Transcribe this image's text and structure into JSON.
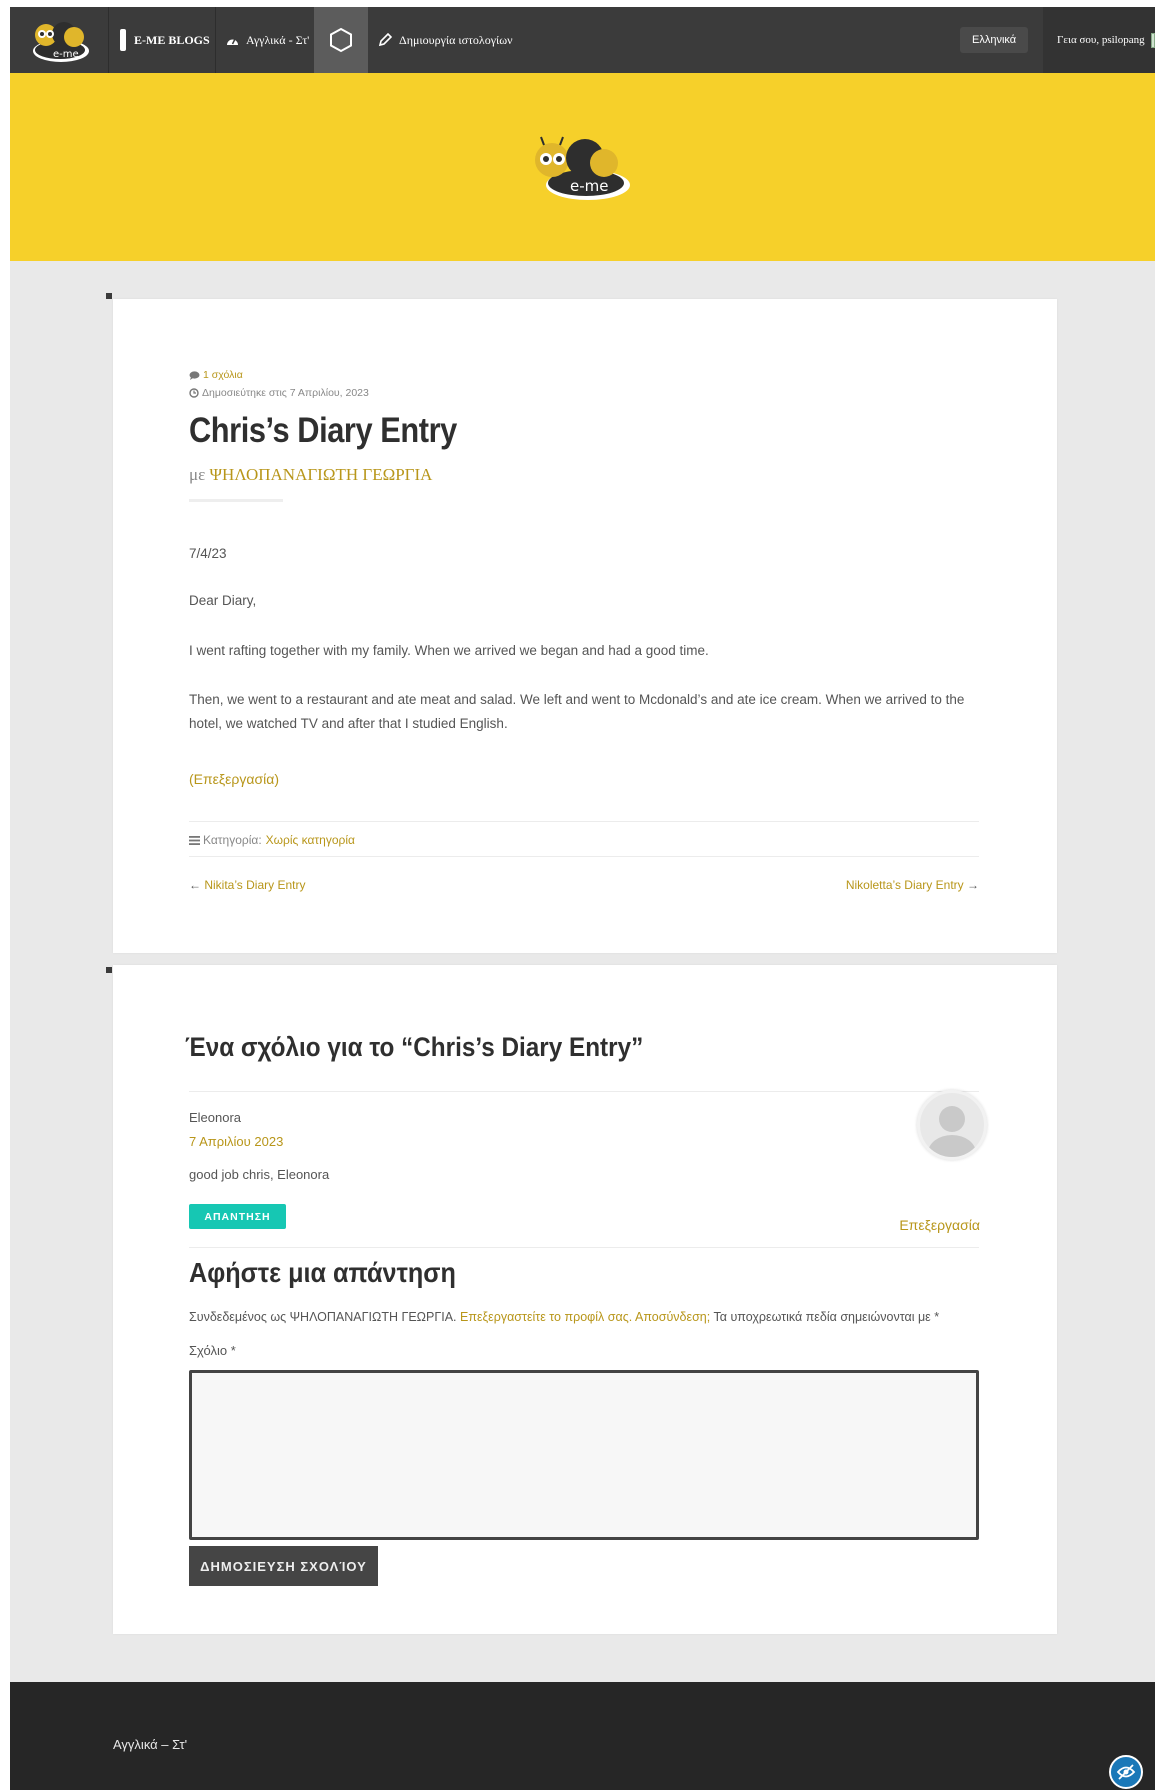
{
  "topbar": {
    "blogs_label": "E-ME BLOGS",
    "site_label": "Αγγλικά - Στ'",
    "create_label": "Δημιουργία ιστολογίων",
    "language_label": "Ελληνικά",
    "greeting": "Γεια σου, psilopang"
  },
  "brand": {
    "logo_text": "e-me"
  },
  "post": {
    "comments_link": "1 σχόλια",
    "published": "Δημοσιεύτηκε στις 7 Απριλίου, 2023",
    "title": "Chris’s Diary Entry",
    "by_prefix": "με",
    "author": "ΨΗΛΟΠΑΝΑΓΙΩΤΗ ΓΕΩΡΓΙΑ",
    "paragraphs": [
      "7/4/23",
      "Dear Diary,",
      "I went rafting together with my family. When we arrived we began and had a good time.",
      "Then, we went to a restaurant and ate meat and salad. We left and went to Mcdonald’s and ate ice cream. When we arrived to the hotel, we watched TV and after that I studied English."
    ],
    "edit_label": "(Επεξεργασία)",
    "category_prefix": "Κατηγορία:",
    "category": "Χωρίς κατηγορία",
    "prev_post": "Nikita’s Diary Entry",
    "next_post": "Nikoletta’s Diary Entry",
    "prev_arrow": "←",
    "next_arrow": "→"
  },
  "comments": {
    "heading": "Ένα σχόλιο για το “Chris’s Diary Entry”",
    "items": [
      {
        "author": "Eleonora",
        "date": "7 Απριλίου 2023",
        "text": "good job chris, Eleonora",
        "reply_label": "ΑΠΑΝΤΗΣΗ",
        "edit_label": "Επεξεργασία"
      }
    ]
  },
  "reply_form": {
    "title": "Αφήστε μια απάντηση",
    "logged_in_prefix": "Συνδεδεμένος ως ΨΗΛΟΠΑΝΑΓΙΩΤΗ ΓΕΩΡΓΙΑ.",
    "edit_profile_link": "Επεξεργαστείτε το προφίλ σας.",
    "logout_link": "Αποσύνδεση;",
    "required_note": "Τα υποχρεωτικά πεδία σημειώνονται με *",
    "comment_label": "Σχόλιο *",
    "comment_value": "",
    "submit_label": "ΔΗΜΟΣΙΕΥΣΗ ΣΧΟΛΊΟΥ"
  },
  "footer": {
    "site_name": "Αγγλικά – Στ'"
  },
  "colors": {
    "accent": "#b8961a",
    "header_yellow": "#f6d02a",
    "reply_teal": "#16c7b3",
    "topbar": "#3b3b3b",
    "footer": "#262626"
  },
  "icons": [
    "bee-logo-icon",
    "pencil-icon",
    "dashboard-icon",
    "hexagon-icon",
    "edit-pencil-icon",
    "comment-icon",
    "clock-icon",
    "menu-lines-icon",
    "default-avatar-icon",
    "accessibility-eye-icon"
  ]
}
